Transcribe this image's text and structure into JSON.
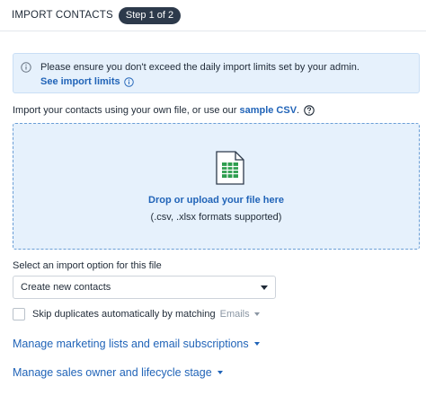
{
  "header": {
    "title": "IMPORT CONTACTS",
    "step_badge": "Step 1 of 2"
  },
  "notice": {
    "icon": "info-circle-icon",
    "text": "Please ensure you don't exceed the daily import limits set by your admin.",
    "link": "See import limits"
  },
  "intro": {
    "text": "Import your contacts using your own file, or use our",
    "link": "sample CSV",
    "suffix": "."
  },
  "dropzone": {
    "icon": "spreadsheet-file-icon",
    "link": "Drop or upload your file here",
    "formats": "(.csv, .xlsx formats supported)"
  },
  "import_option": {
    "label": "Select an import option for this file",
    "selected": "Create new contacts"
  },
  "skip_duplicates": {
    "label": "Skip duplicates automatically by matching",
    "match_field": "Emails",
    "checked": false
  },
  "sections": [
    {
      "label": "Manage marketing lists and email subscriptions"
    },
    {
      "label": "Manage sales owner and lifecycle stage"
    }
  ],
  "colors": {
    "accent": "#2164b8",
    "badge_bg": "#2d3a4b",
    "notice_bg": "#e6f1fc",
    "spreadsheet_green": "#2e9e4f"
  }
}
